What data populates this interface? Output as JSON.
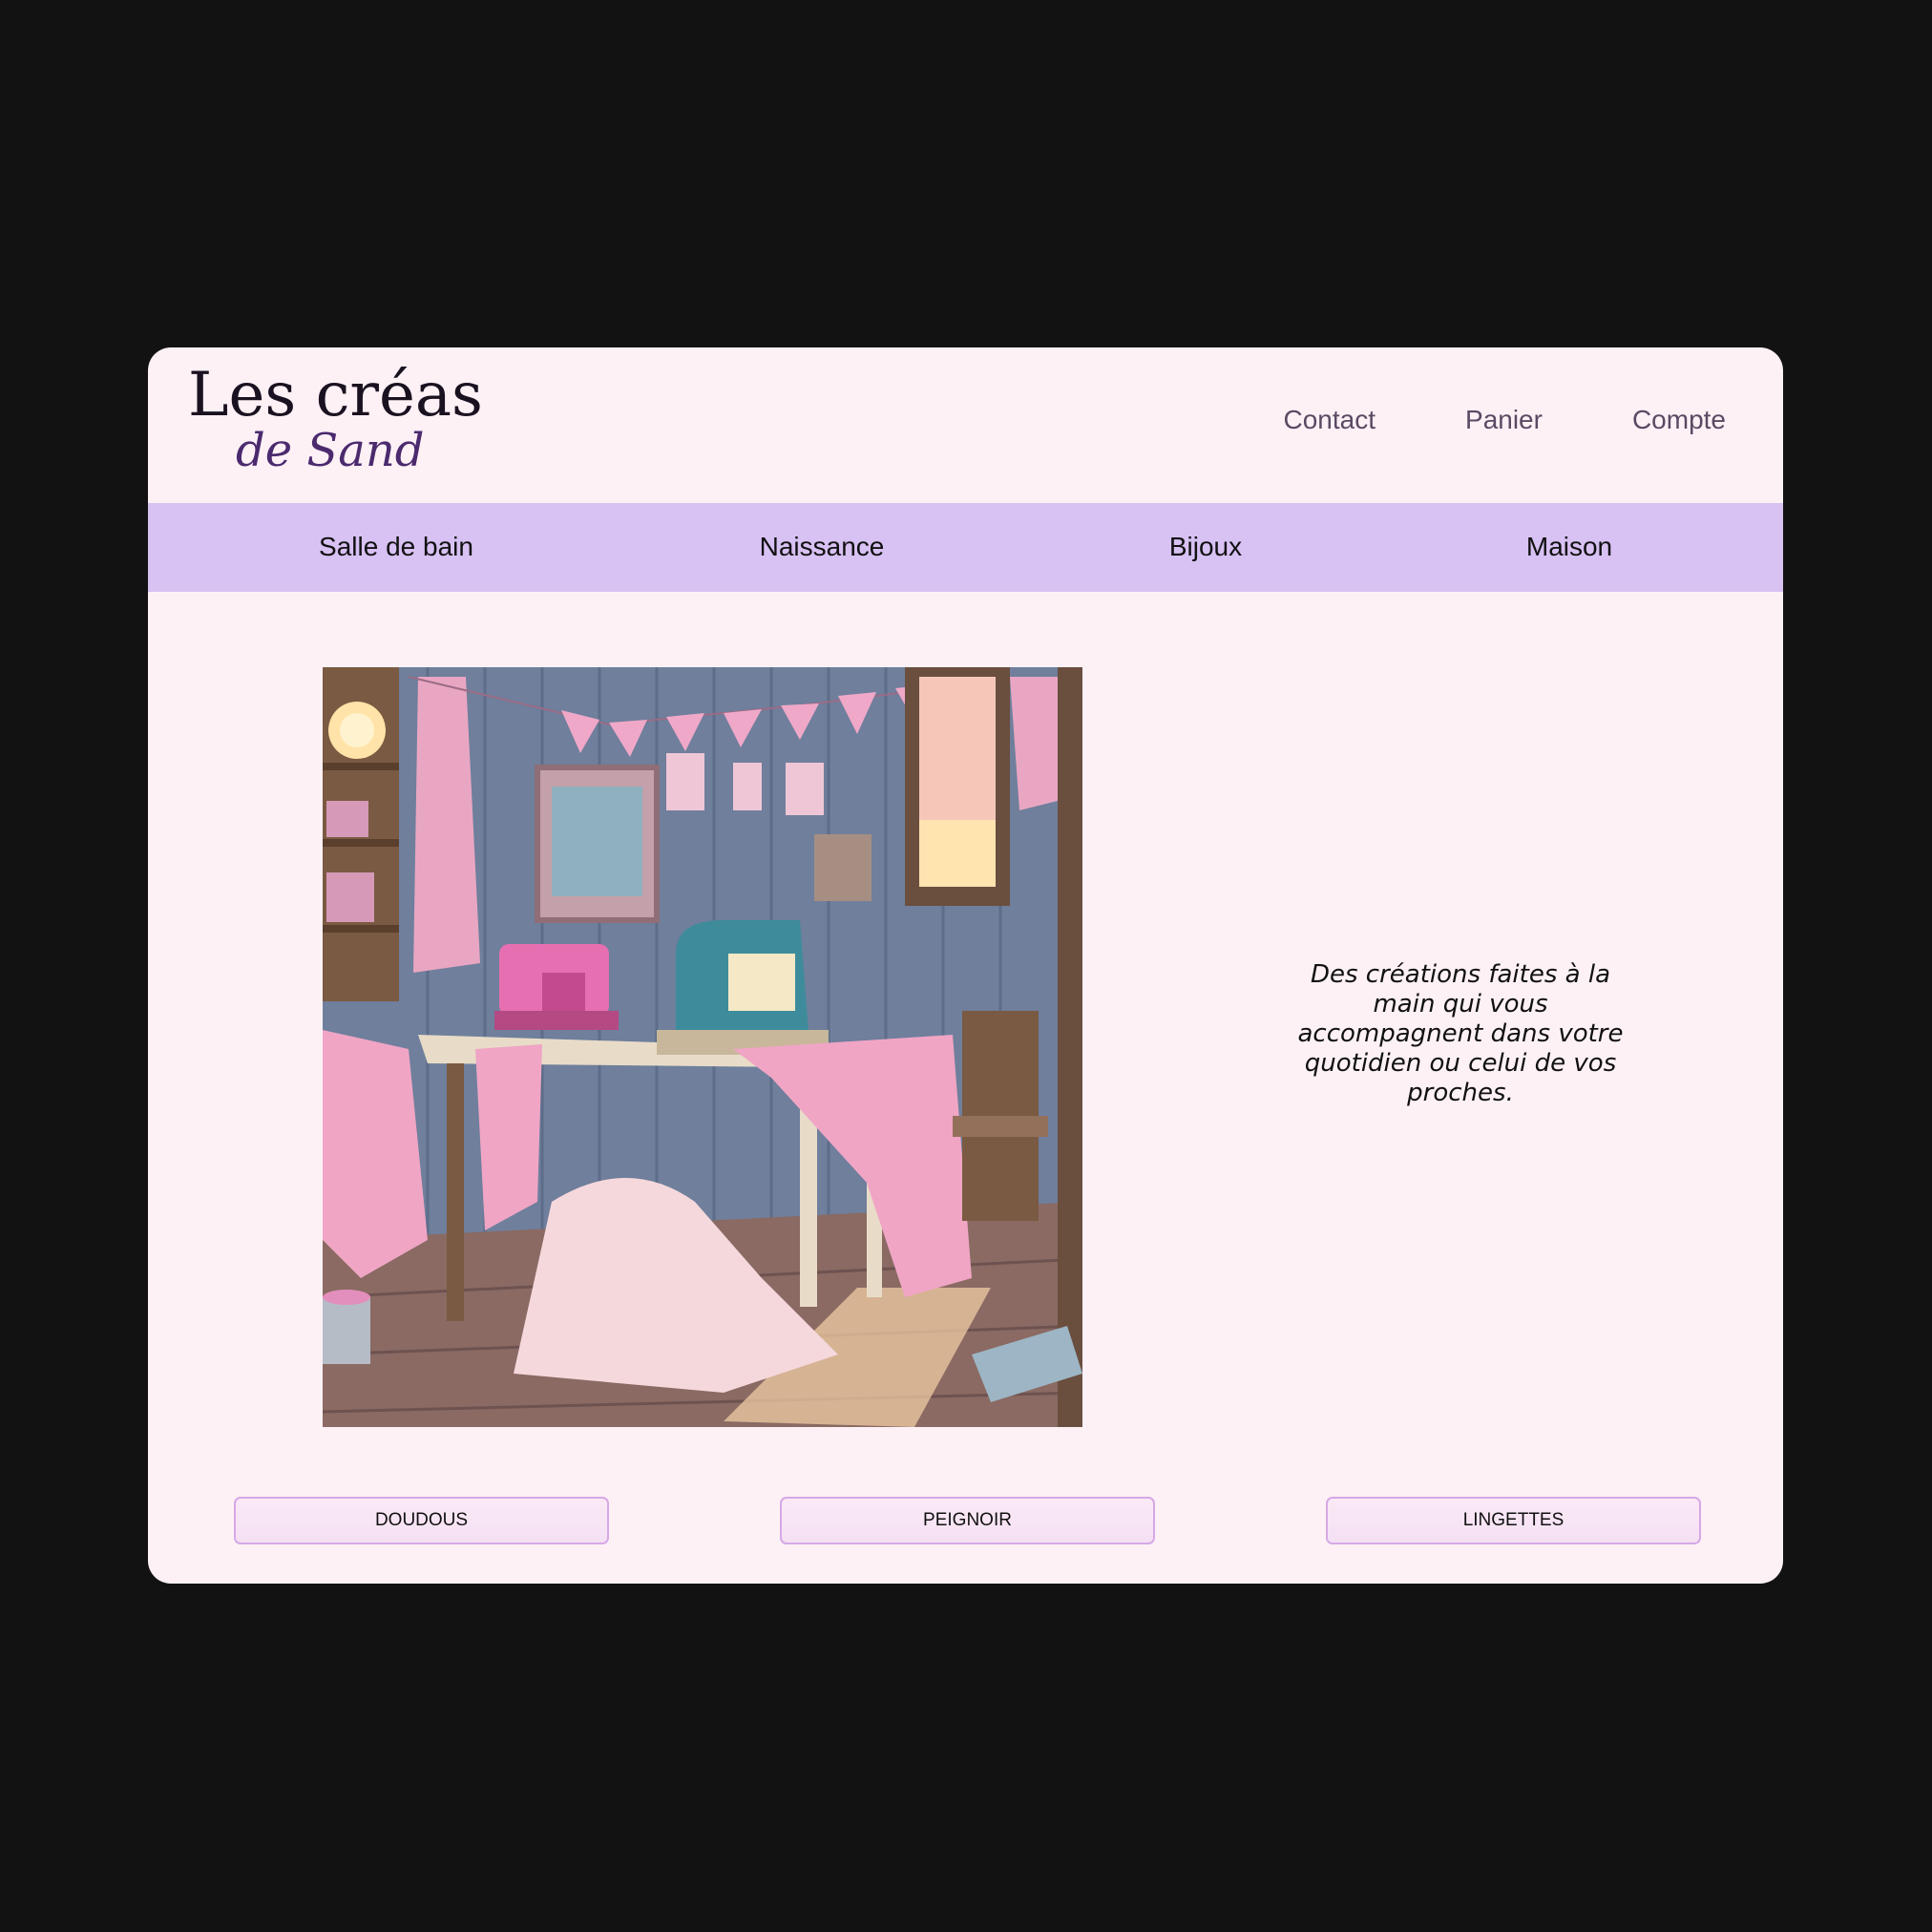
{
  "logo": {
    "main": "Les créas",
    "sub": "de Sand"
  },
  "top_nav": [
    "Contact",
    "Panier",
    "Compte"
  ],
  "categories": [
    "Salle de bain",
    "Naissance",
    "Bijoux",
    "Maison"
  ],
  "hero_image": {
    "description_icon": "sewing-workshop-image"
  },
  "tagline": "Des créations faites à la main qui vous accompagnent dans votre quotidien ou celui de vos proches.",
  "buttons": [
    "DOUDOUS",
    "PEIGNOIR",
    "LINGETTES"
  ],
  "colors": {
    "page_bg": "#121212",
    "card_bg": "#fdf1f6",
    "category_bar": "#d8c1f3",
    "button_border": "#d6a8e6",
    "logo_sub": "#4b2a6e"
  }
}
